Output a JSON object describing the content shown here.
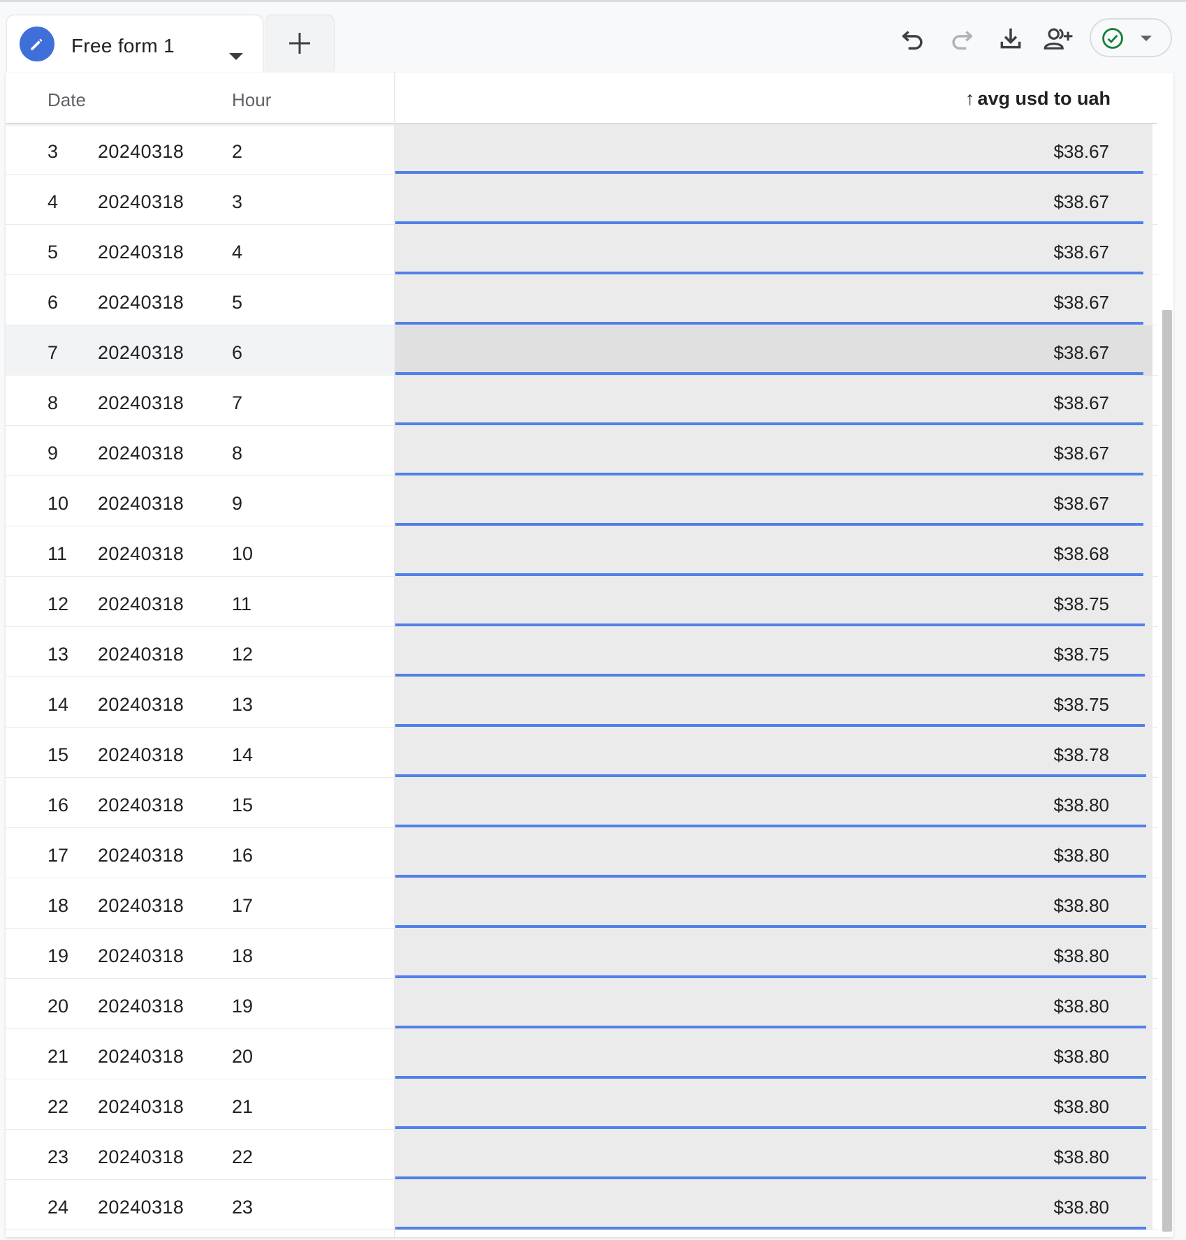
{
  "tab": {
    "label": "Free form 1"
  },
  "toolbar": {
    "undo": "undo-icon",
    "redo": "redo-icon",
    "download": "download-icon",
    "share": "add-person-icon",
    "status": "check-circle-icon"
  },
  "colors": {
    "accent": "#3f6fd8",
    "bar": "#5181e8",
    "status_green": "#188038"
  },
  "table": {
    "headers": {
      "date": "Date",
      "hour": "Hour",
      "metric": "avg usd to uah",
      "sort_indicator": "↑"
    },
    "rows": [
      {
        "index": "3",
        "date": "20240318",
        "hour": "2",
        "value": "$38.67",
        "fraction": 0.988
      },
      {
        "index": "4",
        "date": "20240318",
        "hour": "3",
        "value": "$38.67",
        "fraction": 0.988
      },
      {
        "index": "5",
        "date": "20240318",
        "hour": "4",
        "value": "$38.67",
        "fraction": 0.988
      },
      {
        "index": "6",
        "date": "20240318",
        "hour": "5",
        "value": "$38.67",
        "fraction": 0.988
      },
      {
        "index": "7",
        "date": "20240318",
        "hour": "6",
        "value": "$38.67",
        "fraction": 0.988,
        "hover": true
      },
      {
        "index": "8",
        "date": "20240318",
        "hour": "7",
        "value": "$38.67",
        "fraction": 0.988
      },
      {
        "index": "9",
        "date": "20240318",
        "hour": "8",
        "value": "$38.67",
        "fraction": 0.988
      },
      {
        "index": "10",
        "date": "20240318",
        "hour": "9",
        "value": "$38.67",
        "fraction": 0.988
      },
      {
        "index": "11",
        "date": "20240318",
        "hour": "10",
        "value": "$38.68",
        "fraction": 0.988
      },
      {
        "index": "12",
        "date": "20240318",
        "hour": "11",
        "value": "$38.75",
        "fraction": 0.99
      },
      {
        "index": "13",
        "date": "20240318",
        "hour": "12",
        "value": "$38.75",
        "fraction": 0.99
      },
      {
        "index": "14",
        "date": "20240318",
        "hour": "13",
        "value": "$38.75",
        "fraction": 0.99
      },
      {
        "index": "15",
        "date": "20240318",
        "hour": "14",
        "value": "$38.78",
        "fraction": 0.992
      },
      {
        "index": "16",
        "date": "20240318",
        "hour": "15",
        "value": "$38.80",
        "fraction": 0.992
      },
      {
        "index": "17",
        "date": "20240318",
        "hour": "16",
        "value": "$38.80",
        "fraction": 0.992
      },
      {
        "index": "18",
        "date": "20240318",
        "hour": "17",
        "value": "$38.80",
        "fraction": 0.992
      },
      {
        "index": "19",
        "date": "20240318",
        "hour": "18",
        "value": "$38.80",
        "fraction": 0.992
      },
      {
        "index": "20",
        "date": "20240318",
        "hour": "19",
        "value": "$38.80",
        "fraction": 0.992
      },
      {
        "index": "21",
        "date": "20240318",
        "hour": "20",
        "value": "$38.80",
        "fraction": 0.992
      },
      {
        "index": "22",
        "date": "20240318",
        "hour": "21",
        "value": "$38.80",
        "fraction": 0.992
      },
      {
        "index": "23",
        "date": "20240318",
        "hour": "22",
        "value": "$38.80",
        "fraction": 0.992
      },
      {
        "index": "24",
        "date": "20240318",
        "hour": "23",
        "value": "$38.80",
        "fraction": 0.992
      }
    ]
  }
}
